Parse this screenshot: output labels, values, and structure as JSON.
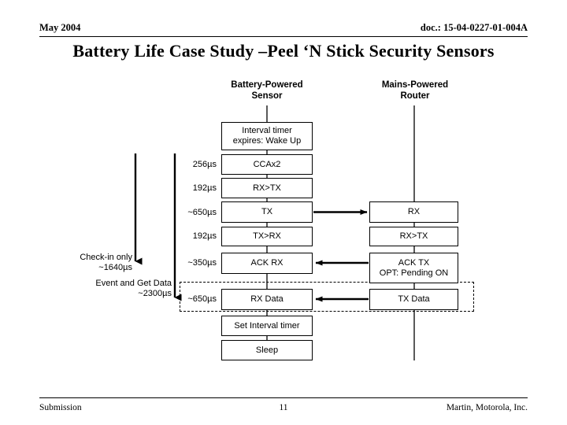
{
  "header": {
    "date": "May 2004",
    "doc": "doc.: 15-04-0227-01-004A"
  },
  "title": "Battery Life Case Study –Peel ‘N Stick Security Sensors",
  "diagram": {
    "columns": {
      "sensor_heading_line1": "Battery-Powered",
      "sensor_heading_line2": "Sensor",
      "router_heading_line1": "Mains-Powered",
      "router_heading_line2": "Router"
    },
    "sensor_steps": [
      {
        "label": "Interval timer\nexpires: Wake Up",
        "time": ""
      },
      {
        "label": "CCAx2",
        "time": "256µs"
      },
      {
        "label": "RX>TX",
        "time": "192µs"
      },
      {
        "label": "TX",
        "time": "~650µs"
      },
      {
        "label": "TX>RX",
        "time": "192µs"
      },
      {
        "label": "ACK RX",
        "time": "~350µs"
      },
      {
        "label": "RX Data",
        "time": "~650µs"
      },
      {
        "label": "Set Interval timer",
        "time": ""
      },
      {
        "label": "Sleep",
        "time": ""
      }
    ],
    "router_steps": [
      {
        "label": "RX"
      },
      {
        "label": "RX>TX"
      },
      {
        "label": "ACK TX\nOPT: Pending ON"
      },
      {
        "label": "TX Data"
      }
    ],
    "span_annotations": [
      {
        "line1": "Check-in only",
        "line2": "~1640µs"
      },
      {
        "line1": "Event and Get Data",
        "line2": "~2300µs"
      }
    ]
  },
  "footer": {
    "left": "Submission",
    "page": "11",
    "right": "Martin, Motorola, Inc."
  }
}
